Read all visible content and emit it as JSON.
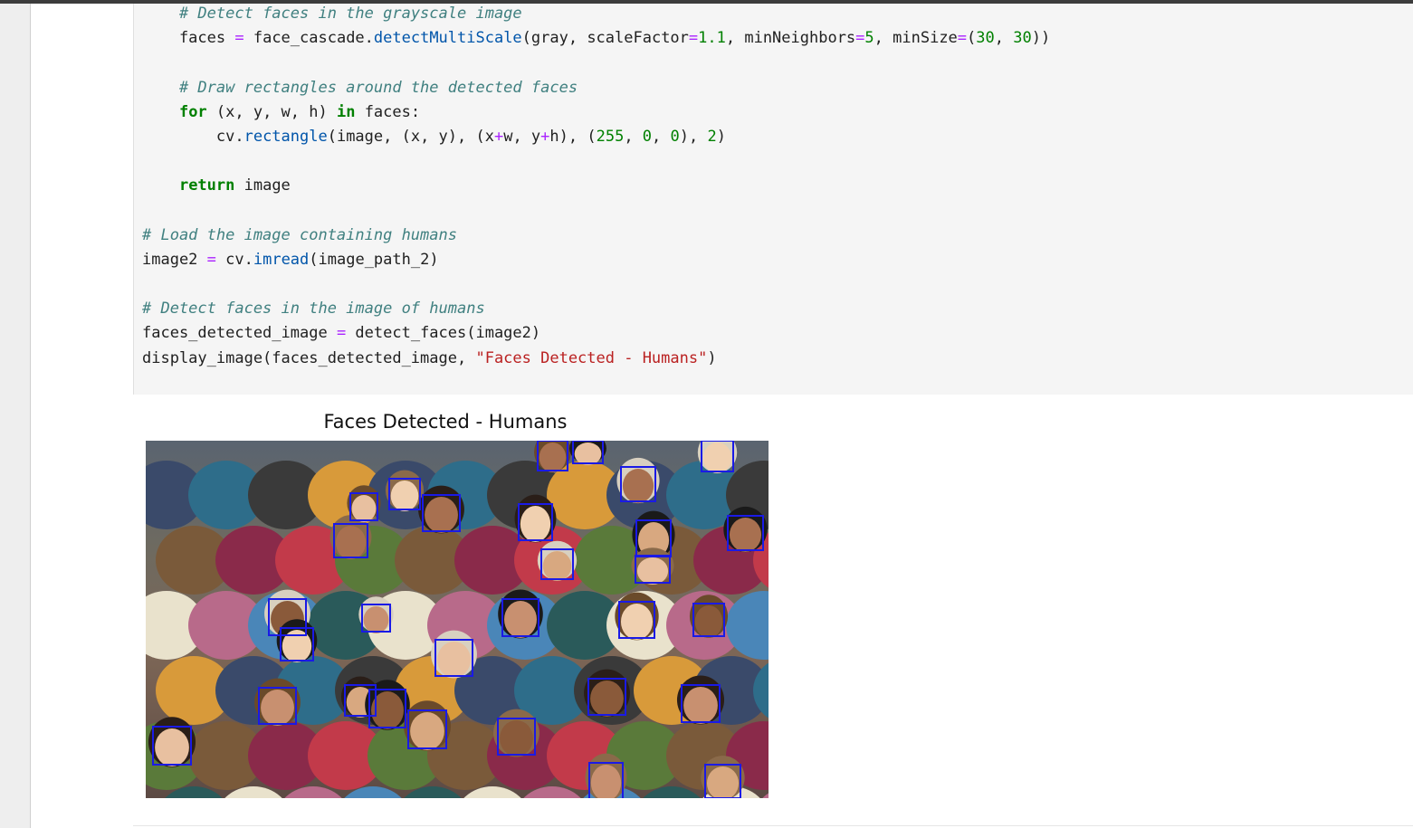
{
  "code_cell": {
    "lines": [
      [
        {
          "t": "    "
        },
        {
          "t": "# Detect faces in the grayscale image",
          "c": "comment"
        }
      ],
      [
        {
          "t": "    faces "
        },
        {
          "t": "=",
          "c": "op"
        },
        {
          "t": " face_cascade."
        },
        {
          "t": "detectMultiScale",
          "c": "fn"
        },
        {
          "t": "(gray, scaleFactor"
        },
        {
          "t": "=",
          "c": "op"
        },
        {
          "t": "1.1",
          "c": "num"
        },
        {
          "t": ", minNeighbors"
        },
        {
          "t": "=",
          "c": "op"
        },
        {
          "t": "5",
          "c": "num"
        },
        {
          "t": ", minSize"
        },
        {
          "t": "=",
          "c": "op"
        },
        {
          "t": "("
        },
        {
          "t": "30",
          "c": "num"
        },
        {
          "t": ", "
        },
        {
          "t": "30",
          "c": "num"
        },
        {
          "t": "))"
        }
      ],
      [],
      [
        {
          "t": "    "
        },
        {
          "t": "# Draw rectangles around the detected faces",
          "c": "comment"
        }
      ],
      [
        {
          "t": "    "
        },
        {
          "t": "for",
          "c": "kw"
        },
        {
          "t": " (x, y, w, h) "
        },
        {
          "t": "in",
          "c": "kw"
        },
        {
          "t": " faces:"
        }
      ],
      [
        {
          "t": "        cv."
        },
        {
          "t": "rectangle",
          "c": "fn"
        },
        {
          "t": "(image, (x, y), (x"
        },
        {
          "t": "+",
          "c": "op"
        },
        {
          "t": "w, y"
        },
        {
          "t": "+",
          "c": "op"
        },
        {
          "t": "h), ("
        },
        {
          "t": "255",
          "c": "num"
        },
        {
          "t": ", "
        },
        {
          "t": "0",
          "c": "num"
        },
        {
          "t": ", "
        },
        {
          "t": "0",
          "c": "num"
        },
        {
          "t": "), "
        },
        {
          "t": "2",
          "c": "num"
        },
        {
          "t": ")"
        }
      ],
      [],
      [
        {
          "t": "    "
        },
        {
          "t": "return",
          "c": "kw"
        },
        {
          "t": " image"
        }
      ],
      [],
      [
        {
          "t": "# Load the image containing humans",
          "c": "comment"
        }
      ],
      [
        {
          "t": "image2 "
        },
        {
          "t": "=",
          "c": "op"
        },
        {
          "t": " cv."
        },
        {
          "t": "imread",
          "c": "fn"
        },
        {
          "t": "(image_path_2)"
        }
      ],
      [],
      [
        {
          "t": "# Detect faces in the image of humans",
          "c": "comment"
        }
      ],
      [
        {
          "t": "faces_detected_image "
        },
        {
          "t": "=",
          "c": "op"
        },
        {
          "t": " detect_faces(image2)"
        }
      ],
      [
        {
          "t": "display_image(faces_detected_image, "
        },
        {
          "t": "\"Faces Detected - Humans\"",
          "c": "str"
        },
        {
          "t": ")"
        }
      ]
    ]
  },
  "output": {
    "figure_title": "Faces Detected - Humans"
  },
  "colors": {
    "face_box": "#1a1ae6"
  }
}
